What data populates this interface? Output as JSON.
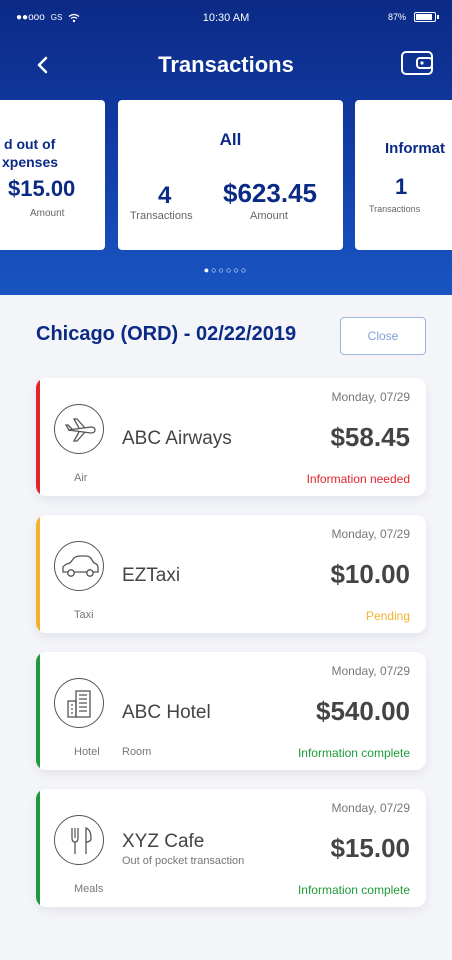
{
  "status_bar": {
    "signal": "●●ooo",
    "carrier": "GS",
    "wifi": "wifi-icon",
    "time": "10:30 AM",
    "battery": "87%"
  },
  "nav": {
    "title": "Transactions",
    "back_icon": "chevron-left-icon",
    "wallet_icon": "wallet-icon"
  },
  "summary": {
    "left": {
      "title_line1": "d out of",
      "title_line2": "xpenses",
      "value": "$15.00",
      "value_label": "Amount"
    },
    "center": {
      "title": "All",
      "count": "4",
      "count_label": "Transactions",
      "amount": "$623.45",
      "amount_label": "Amount"
    },
    "right": {
      "title": "Informat",
      "count": "1",
      "count_label": "Transactions"
    },
    "pager": "●○○○○○"
  },
  "group": {
    "title": "Chicago (ORD) - 02/22/2019",
    "close_label": "Close"
  },
  "transactions": [
    {
      "date": "Monday, 07/29",
      "name": "ABC Airways",
      "subname": "",
      "amount": "$58.45",
      "category": "Air",
      "subcategory": "",
      "status": "Information needed",
      "icon": "airplane-icon",
      "accent": "#e0262b",
      "status_color": "#e0262b"
    },
    {
      "date": "Monday, 07/29",
      "name": "EZTaxi",
      "subname": "",
      "amount": "$10.00",
      "category": "Taxi",
      "subcategory": "",
      "status": "Pending",
      "icon": "car-icon",
      "accent": "#f2b22f",
      "status_color": "#f2b22f"
    },
    {
      "date": "Monday, 07/29",
      "name": "ABC Hotel",
      "subname": "",
      "amount": "$540.00",
      "category": "Hotel",
      "subcategory": "Room",
      "status": "Information complete",
      "icon": "hotel-icon",
      "accent": "#1f9a3a",
      "status_color": "#1f9a3a"
    },
    {
      "date": "Monday, 07/29",
      "name": "XYZ Cafe",
      "subname": "Out of pocket transaction",
      "amount": "$15.00",
      "category": "Meals",
      "subcategory": "",
      "status": "Information complete",
      "icon": "meal-icon",
      "accent": "#1f9a3a",
      "status_color": "#1f9a3a"
    }
  ]
}
